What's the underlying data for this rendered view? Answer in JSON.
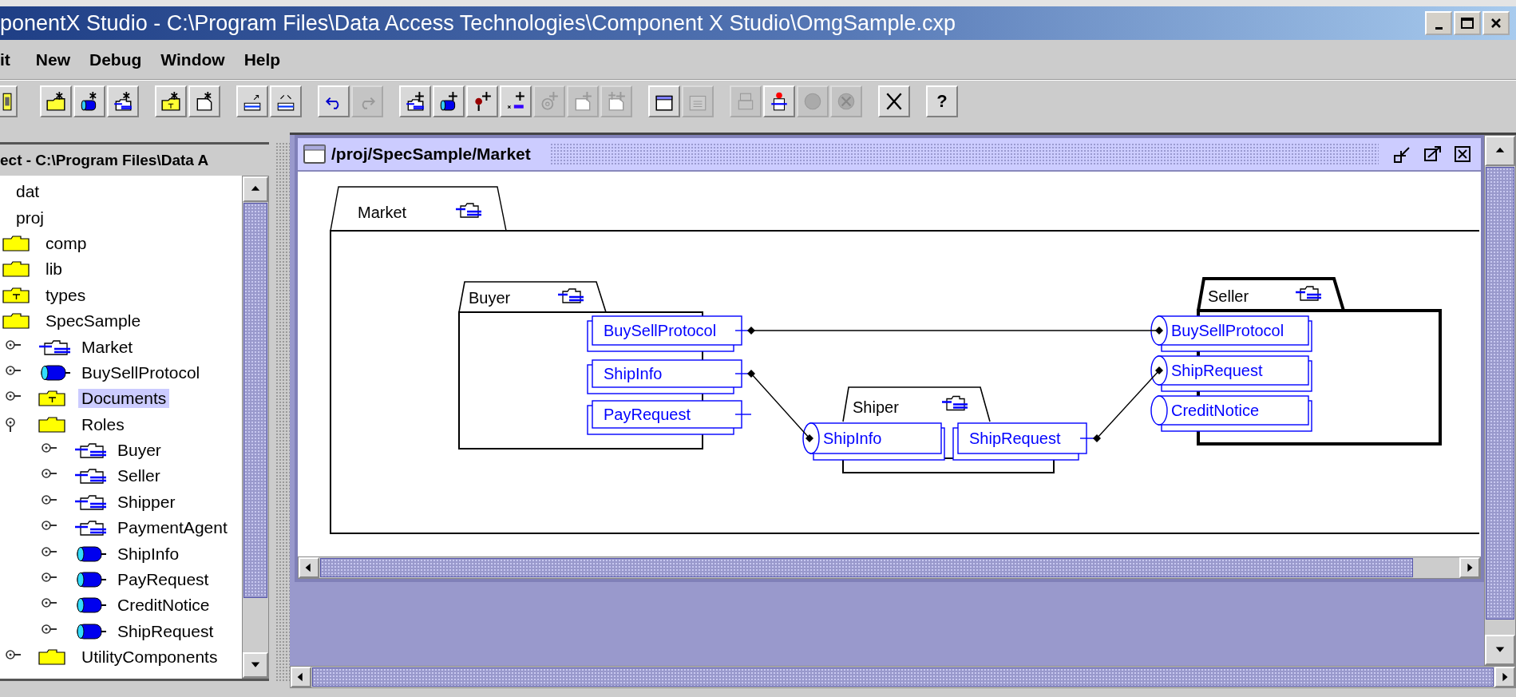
{
  "window": {
    "title": "ponentX Studio - C:\\Program Files\\Data Access Technologies\\Component X Studio\\OmgSample.cxp"
  },
  "menu": [
    "it",
    "New",
    "Debug",
    "Window",
    "Help"
  ],
  "toolbar": [
    [
      {
        "kind": "panel",
        "disabled": false
      }
    ],
    [
      {
        "kind": "folder-asterisk",
        "disabled": false
      },
      {
        "kind": "cylinder-asterisk",
        "disabled": false
      },
      {
        "kind": "package-asterisk",
        "disabled": false
      }
    ],
    [
      {
        "kind": "typed-folder-asterisk",
        "disabled": false
      },
      {
        "kind": "page-asterisk",
        "disabled": false
      }
    ],
    [
      {
        "kind": "tray-arrow",
        "disabled": false
      },
      {
        "kind": "tray-arrows",
        "disabled": false
      }
    ],
    [
      {
        "kind": "undo",
        "disabled": false
      },
      {
        "kind": "redo",
        "disabled": true
      }
    ],
    [
      {
        "kind": "package-plus",
        "disabled": false
      },
      {
        "kind": "cylinder-plus",
        "disabled": false
      },
      {
        "kind": "pin-plus",
        "disabled": false
      },
      {
        "kind": "field-plus",
        "disabled": false
      },
      {
        "kind": "at-plus",
        "disabled": true
      },
      {
        "kind": "page-plus",
        "disabled": true
      },
      {
        "kind": "double-plus",
        "disabled": true
      }
    ],
    [
      {
        "kind": "window",
        "disabled": false
      },
      {
        "kind": "grid-window",
        "disabled": true
      }
    ],
    [
      {
        "kind": "stack",
        "disabled": true
      },
      {
        "kind": "stack-light",
        "disabled": false
      },
      {
        "kind": "circle",
        "disabled": true
      },
      {
        "kind": "wrench-circle",
        "disabled": true
      }
    ],
    [
      {
        "kind": "cross",
        "disabled": false
      }
    ],
    [
      {
        "kind": "text",
        "label": "?",
        "disabled": false
      }
    ]
  ],
  "project_panel": {
    "title": "ect - C:\\Program Files\\Data A",
    "tree": [
      {
        "label": "dat",
        "kind": "plain",
        "selected": false
      },
      {
        "label": "proj",
        "kind": "plain",
        "selected": false,
        "children": [
          {
            "label": "comp",
            "kind": "folder",
            "selected": false
          },
          {
            "label": "lib",
            "kind": "folder",
            "selected": false
          },
          {
            "label": "types",
            "kind": "typed-folder",
            "selected": false
          },
          {
            "label": "SpecSample",
            "kind": "folder",
            "selected": false,
            "children": [
              {
                "label": "Market",
                "kind": "component",
                "selected": false,
                "expanded": false
              },
              {
                "label": "BuySellProtocol",
                "kind": "interface",
                "selected": false,
                "expanded": false
              },
              {
                "label": "Documents",
                "kind": "typed-folder",
                "selected": true,
                "expanded": false
              },
              {
                "label": "Roles",
                "kind": "folder",
                "selected": false,
                "expanded": true,
                "children": [
                  {
                    "label": "Buyer",
                    "kind": "component",
                    "selected": false,
                    "expanded": false
                  },
                  {
                    "label": "Seller",
                    "kind": "component",
                    "selected": false,
                    "expanded": false
                  },
                  {
                    "label": "Shipper",
                    "kind": "component",
                    "selected": false,
                    "expanded": false
                  },
                  {
                    "label": "PaymentAgent",
                    "kind": "component",
                    "selected": false,
                    "expanded": false
                  },
                  {
                    "label": "ShipInfo",
                    "kind": "interface",
                    "selected": false,
                    "expanded": false
                  },
                  {
                    "label": "PayRequest",
                    "kind": "interface",
                    "selected": false,
                    "expanded": false
                  },
                  {
                    "label": "CreditNotice",
                    "kind": "interface",
                    "selected": false,
                    "expanded": false
                  },
                  {
                    "label": "ShipRequest",
                    "kind": "interface",
                    "selected": false,
                    "expanded": false
                  }
                ]
              },
              {
                "label": "UtilityComponents",
                "kind": "folder",
                "selected": false,
                "expanded": false
              }
            ]
          }
        ]
      }
    ]
  },
  "editor": {
    "title": "/proj/SpecSample/Market",
    "diagram": {
      "package": "Market",
      "roles": [
        {
          "name": "Buyer",
          "selected": false,
          "ports": [
            {
              "label": "BuySellProtocol",
              "kind": "box"
            },
            {
              "label": "ShipInfo",
              "kind": "box"
            },
            {
              "label": "PayRequest",
              "kind": "box"
            }
          ]
        },
        {
          "name": "Seller",
          "selected": true,
          "ports": [
            {
              "label": "BuySellProtocol",
              "kind": "cylinder"
            },
            {
              "label": "ShipRequest",
              "kind": "cylinder"
            },
            {
              "label": "CreditNotice",
              "kind": "cylinder"
            }
          ]
        },
        {
          "name": "Shiper",
          "selected": false,
          "ports": [
            {
              "label": "ShipInfo",
              "kind": "cylinder"
            },
            {
              "label": "ShipRequest",
              "kind": "box"
            }
          ]
        }
      ]
    }
  }
}
